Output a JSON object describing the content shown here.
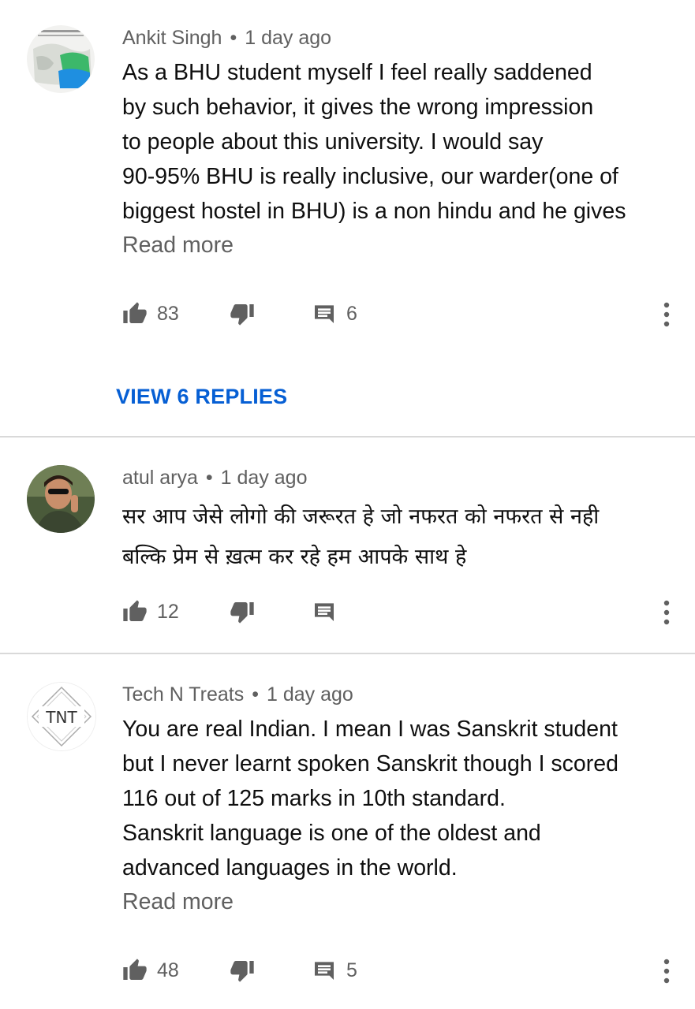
{
  "comments": [
    {
      "author": "Ankit Singh",
      "time": "1 day ago",
      "text": "As a BHU student myself I feel really saddened\nby such behavior, it gives the wrong impression\nto people about this university. I would say\n90-95% BHU is really inclusive, our warder(one of\nbiggest hostel in BHU) is a non hindu and he gives",
      "read_more": "Read more",
      "likes": "83",
      "replies": "6",
      "view_replies": "VIEW 6 REPLIES"
    },
    {
      "author": "atul arya",
      "time": "1 day ago",
      "text": "सर आप जेसे लोगो की जरूरत हे जो नफरत को नफरत से नही\nबल्कि प्रेम से ख़त्म कर रहे हम आपके साथ हे",
      "likes": "12",
      "replies": ""
    },
    {
      "author": "Tech N Treats",
      "avatar_text": "TNT",
      "time": "1 day ago",
      "text": "You are real Indian. I mean I was Sanskrit student\nbut I never learnt spoken Sanskrit though I scored\n116 out of 125 marks in 10th standard.\nSanskrit language is one of the oldest and\nadvanced languages in the world.",
      "read_more": "Read more",
      "likes": "48",
      "replies": "5"
    }
  ],
  "separator": "•",
  "colors": {
    "link": "#065fd4",
    "secondary_text": "#606060",
    "divider": "#d9d9d9"
  },
  "icons": [
    "thumb-up-icon",
    "thumb-down-icon",
    "reply-icon",
    "more-vert-icon"
  ]
}
